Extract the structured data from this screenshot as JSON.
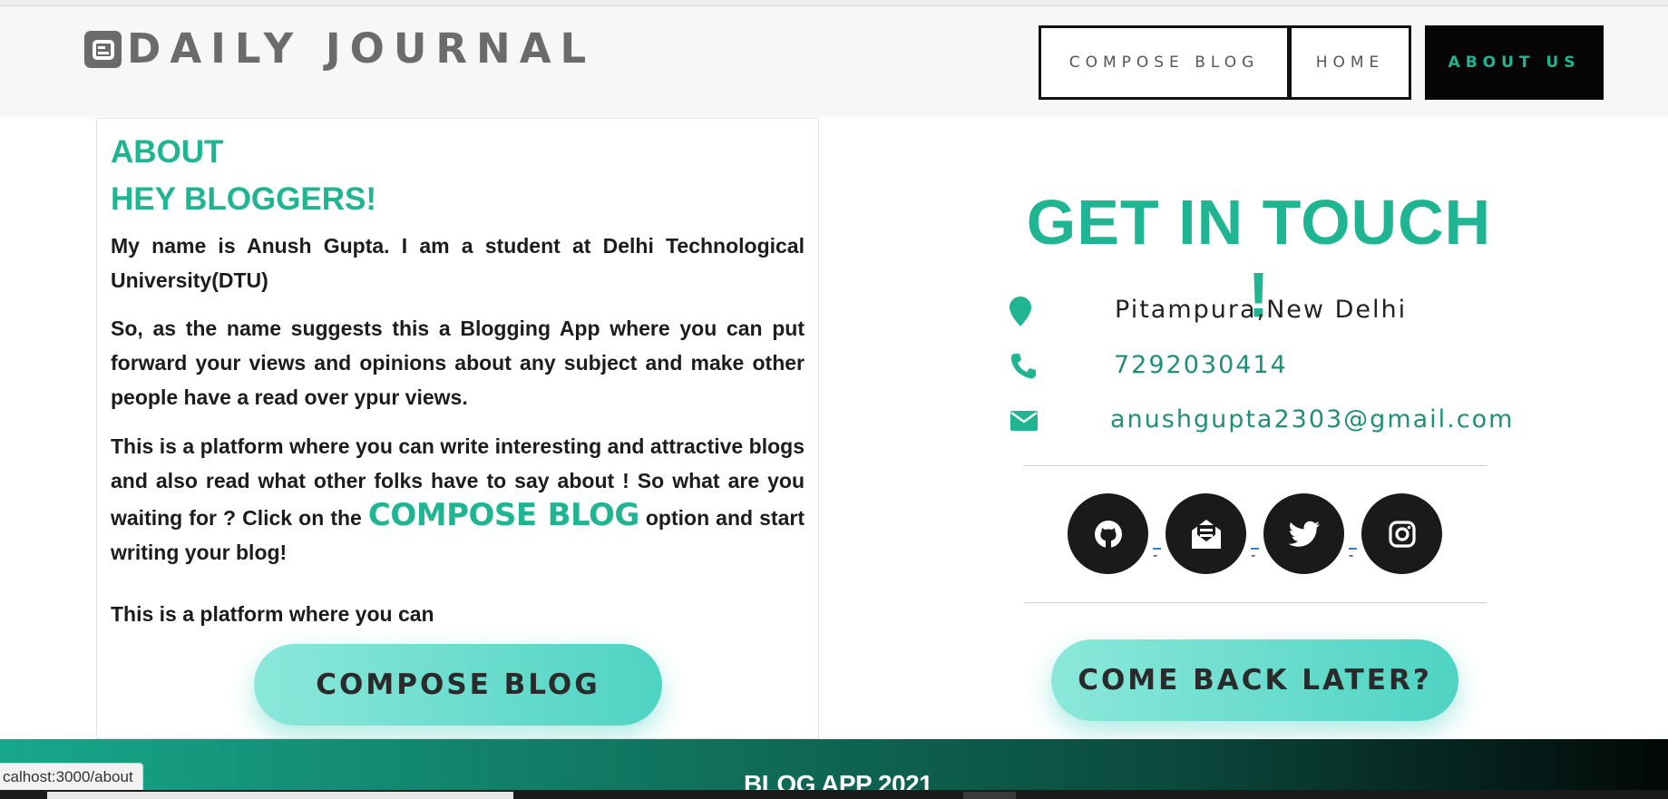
{
  "header": {
    "brand": "DAILY JOURNAL",
    "brand_icon": "blogger-icon",
    "nav": [
      {
        "label": "COMPOSE BLOG"
      },
      {
        "label": "HOME"
      },
      {
        "label": "ABOUT US"
      }
    ]
  },
  "about": {
    "heading": "ABOUT",
    "subheading": "HEY BLOGGERS!",
    "p1": "My name is Anush Gupta. I am a student at Delhi Technological University(DTU)",
    "p2": "So, as the name suggests this a Blogging App where you can put forward your views and opinions about any subject and make other people have a read over ypur views.",
    "p3_before": "This is a platform where you can write interesting and attractive blogs and also read what other folks have to say about ! So what are you waiting for ? Click on the ",
    "p3_highlight": "COMPOSE BLOG",
    "p3_after": " option and start writing your blog!",
    "p4": "This is a platform where you can",
    "button": "COMPOSE BLOG"
  },
  "contact": {
    "title": "GET IN TOUCH !",
    "location": "Pitampura,New Delhi",
    "phone": "7292030414",
    "email": "anushgupta2303@gmail.com",
    "social": [
      "github-icon",
      "blog-icon",
      "twitter-icon",
      "instagram-icon"
    ],
    "dash": "-",
    "button": "COME BACK LATER?"
  },
  "footer": {
    "text": "BLOG APP 2021"
  },
  "status_bar": {
    "url": "calhost:3000/about"
  },
  "colors": {
    "accent": "#1fb592",
    "nav_active_bg": "#050505",
    "brand_gray": "#6b6b6b"
  }
}
